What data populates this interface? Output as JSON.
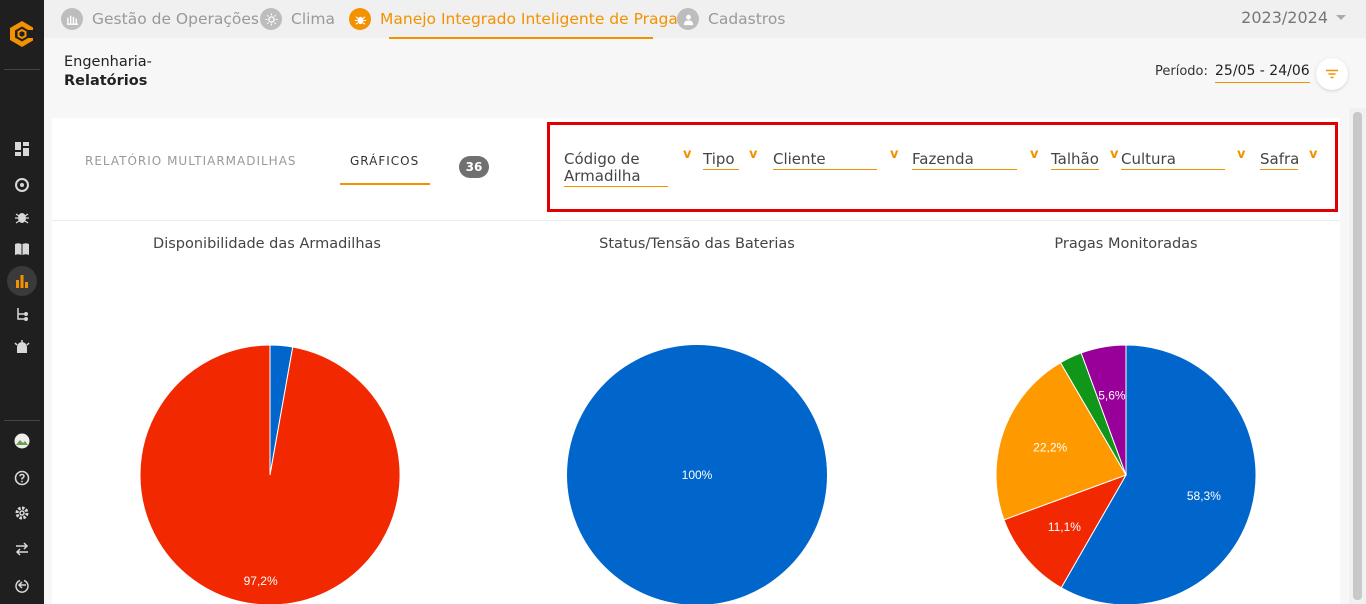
{
  "topnav": {
    "items": [
      {
        "label": "Gestão de Operações",
        "icon": "operations-icon",
        "active": false
      },
      {
        "label": "Clima",
        "icon": "sun-icon",
        "active": false
      },
      {
        "label": "Manejo Integrado Inteligente de Pragas",
        "icon": "bug-icon",
        "active": true
      },
      {
        "label": "Cadastros",
        "icon": "user-icon",
        "active": false
      }
    ],
    "season": "2023/2024"
  },
  "sidebar": {
    "icons": [
      "dashboard-icon",
      "radar-icon",
      "bug-icon",
      "book-icon",
      "bar-chart-icon",
      "branch-icon",
      "alarm-icon",
      "avatar",
      "help-icon",
      "settings-icon",
      "swap-icon",
      "logout-icon"
    ]
  },
  "header": {
    "breadcrumb_parent": "Engenharia-",
    "breadcrumb_current": "Relatórios",
    "period_label": "Período:",
    "period_value": "25/05 - 24/06"
  },
  "tabs": [
    {
      "label": "RELATÓRIO MULTIARMADILHAS",
      "active": false
    },
    {
      "label": "GRÁFICOS",
      "active": true
    }
  ],
  "count_badge": "36",
  "filters": {
    "codigo_l1": "Código de",
    "codigo_l2": "Armadilha",
    "tipo": "Tipo",
    "cliente": "Cliente",
    "fazenda": "Fazenda",
    "talhao": "Talhão",
    "cultura": "Cultura",
    "safra": "Safra",
    "chevron": "v"
  },
  "colors": {
    "accent": "#f39200",
    "blue": "#0066cc",
    "red": "#f22800",
    "orange": "#ff9900",
    "green": "#109618",
    "purple": "#990099",
    "highlight_box": "#e00000"
  },
  "chart_data": [
    {
      "type": "pie",
      "title": "Disponibilidade das Armadilhas",
      "slices": [
        {
          "value": 2.8,
          "color": "#0066cc",
          "label": ""
        },
        {
          "value": 97.2,
          "color": "#f22800",
          "label": "97,2%"
        }
      ]
    },
    {
      "type": "pie",
      "title": "Status/Tensão das Baterias",
      "slices": [
        {
          "value": 100,
          "color": "#0066cc",
          "label": "100%"
        }
      ]
    },
    {
      "type": "pie",
      "title": "Pragas Monitoradas",
      "slices": [
        {
          "value": 58.3,
          "color": "#0066cc",
          "label": "58,3%"
        },
        {
          "value": 11.1,
          "color": "#f22800",
          "label": "11,1%"
        },
        {
          "value": 22.2,
          "color": "#ff9900",
          "label": "22,2%"
        },
        {
          "value": 2.8,
          "color": "#109618",
          "label": ""
        },
        {
          "value": 5.6,
          "color": "#990099",
          "label": "5,6%"
        }
      ]
    }
  ]
}
